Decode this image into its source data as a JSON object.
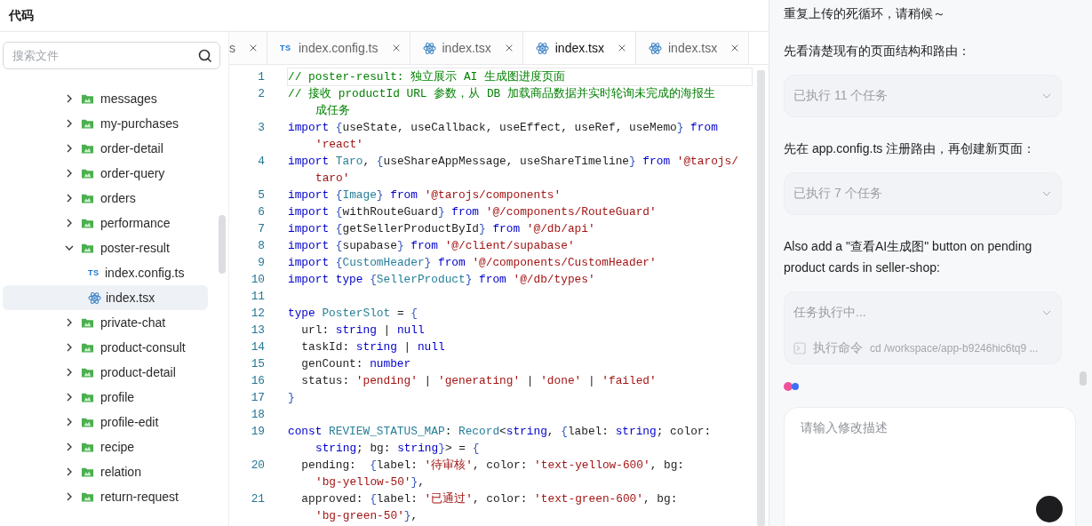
{
  "header": {
    "title": "代码"
  },
  "sidebar": {
    "search": {
      "placeholder": "搜索文件"
    },
    "tree": [
      {
        "kind": "folder",
        "label": "messages",
        "expanded": false,
        "selected": false
      },
      {
        "kind": "folder",
        "label": "my-purchases",
        "expanded": false,
        "selected": false
      },
      {
        "kind": "folder",
        "label": "order-detail",
        "expanded": false,
        "selected": false
      },
      {
        "kind": "folder",
        "label": "order-query",
        "expanded": false,
        "selected": false
      },
      {
        "kind": "folder",
        "label": "orders",
        "expanded": false,
        "selected": false
      },
      {
        "kind": "folder",
        "label": "performance",
        "expanded": false,
        "selected": false
      },
      {
        "kind": "folder",
        "label": "poster-result",
        "expanded": true,
        "selected": false,
        "children": [
          {
            "kind": "ts",
            "badge": "TS",
            "label": "index.config.ts",
            "selected": false
          },
          {
            "kind": "tsx",
            "label": "index.tsx",
            "selected": true
          }
        ]
      },
      {
        "kind": "folder",
        "label": "private-chat",
        "expanded": false,
        "selected": false
      },
      {
        "kind": "folder",
        "label": "product-consult",
        "expanded": false,
        "selected": false
      },
      {
        "kind": "folder",
        "label": "product-detail",
        "expanded": false,
        "selected": false
      },
      {
        "kind": "folder",
        "label": "profile",
        "expanded": false,
        "selected": false
      },
      {
        "kind": "folder",
        "label": "profile-edit",
        "expanded": false,
        "selected": false
      },
      {
        "kind": "folder",
        "label": "recipe",
        "expanded": false,
        "selected": false
      },
      {
        "kind": "folder",
        "label": "relation",
        "expanded": false,
        "selected": false
      },
      {
        "kind": "folder",
        "label": "return-request",
        "expanded": false,
        "selected": false
      }
    ]
  },
  "editor": {
    "tabs": [
      {
        "kind": "plain",
        "label": "s",
        "selected": false
      },
      {
        "kind": "ts",
        "badge": "TS",
        "label": "index.config.ts",
        "selected": false
      },
      {
        "kind": "tsx",
        "label": "index.tsx",
        "selected": false
      },
      {
        "kind": "tsx",
        "label": "index.tsx",
        "selected": true
      },
      {
        "kind": "tsx",
        "label": "index.tsx",
        "selected": false
      }
    ],
    "lines": [
      {
        "number": "1",
        "current": true,
        "rows": [
          {
            "tokens": [
              {
                "kind": "cm",
                "text": "// poster-result: 独立展示 AI 生成图进度页面"
              }
            ]
          }
        ]
      },
      {
        "number": "2",
        "current": false,
        "rows": [
          {
            "tokens": [
              {
                "kind": "cm",
                "text": "// 接收 productId URL 参数，从 DB 加载商品数据并实时轮询未完成的海报生"
              }
            ]
          },
          {
            "tokens": [
              {
                "kind": "cm",
                "text": "成任务"
              }
            ]
          }
        ]
      },
      {
        "number": "3",
        "current": false,
        "rows": [
          {
            "tokens": [
              {
                "kind": "kw",
                "text": "import "
              },
              {
                "kind": "br",
                "text": "{"
              },
              {
                "kind": "pl",
                "text": "useState, useCallback, useEffect, useRef, useMemo"
              },
              {
                "kind": "br",
                "text": "} "
              },
              {
                "kind": "kw",
                "text": "from"
              }
            ]
          },
          {
            "tokens": [
              {
                "kind": "st",
                "text": "'react'"
              }
            ]
          }
        ]
      },
      {
        "number": "4",
        "current": false,
        "rows": [
          {
            "tokens": [
              {
                "kind": "kw",
                "text": "import "
              },
              {
                "kind": "ty",
                "text": "Taro"
              },
              {
                "kind": "pl",
                "text": ", "
              },
              {
                "kind": "br",
                "text": "{"
              },
              {
                "kind": "pl",
                "text": "useShareAppMessage, useShareTimeline"
              },
              {
                "kind": "br",
                "text": "} "
              },
              {
                "kind": "kw",
                "text": "from "
              },
              {
                "kind": "st",
                "text": "'@tarojs/"
              }
            ]
          },
          {
            "tokens": [
              {
                "kind": "st",
                "text": "taro'"
              }
            ]
          }
        ]
      },
      {
        "number": "5",
        "current": false,
        "rows": [
          {
            "tokens": [
              {
                "kind": "kw",
                "text": "import "
              },
              {
                "kind": "br",
                "text": "{"
              },
              {
                "kind": "ty",
                "text": "Image"
              },
              {
                "kind": "br",
                "text": "} "
              },
              {
                "kind": "kw",
                "text": "from "
              },
              {
                "kind": "st",
                "text": "'@tarojs/components'"
              }
            ]
          }
        ]
      },
      {
        "number": "6",
        "current": false,
        "rows": [
          {
            "tokens": [
              {
                "kind": "kw",
                "text": "import "
              },
              {
                "kind": "br",
                "text": "{"
              },
              {
                "kind": "pl",
                "text": "withRouteGuard"
              },
              {
                "kind": "br",
                "text": "} "
              },
              {
                "kind": "kw",
                "text": "from "
              },
              {
                "kind": "st",
                "text": "'@/components/RouteGuard'"
              }
            ]
          }
        ]
      },
      {
        "number": "7",
        "current": false,
        "rows": [
          {
            "tokens": [
              {
                "kind": "kw",
                "text": "import "
              },
              {
                "kind": "br",
                "text": "{"
              },
              {
                "kind": "pl",
                "text": "getSellerProductById"
              },
              {
                "kind": "br",
                "text": "} "
              },
              {
                "kind": "kw",
                "text": "from "
              },
              {
                "kind": "st",
                "text": "'@/db/api'"
              }
            ]
          }
        ]
      },
      {
        "number": "8",
        "current": false,
        "rows": [
          {
            "tokens": [
              {
                "kind": "kw",
                "text": "import "
              },
              {
                "kind": "br",
                "text": "{"
              },
              {
                "kind": "pl",
                "text": "supabase"
              },
              {
                "kind": "br",
                "text": "} "
              },
              {
                "kind": "kw",
                "text": "from "
              },
              {
                "kind": "st",
                "text": "'@/client/supabase'"
              }
            ]
          }
        ]
      },
      {
        "number": "9",
        "current": false,
        "rows": [
          {
            "tokens": [
              {
                "kind": "kw",
                "text": "import "
              },
              {
                "kind": "br",
                "text": "{"
              },
              {
                "kind": "ty",
                "text": "CustomHeader"
              },
              {
                "kind": "br",
                "text": "} "
              },
              {
                "kind": "kw",
                "text": "from "
              },
              {
                "kind": "st",
                "text": "'@/components/CustomHeader'"
              }
            ]
          }
        ]
      },
      {
        "number": "10",
        "current": false,
        "rows": [
          {
            "tokens": [
              {
                "kind": "kw",
                "text": "import type "
              },
              {
                "kind": "br",
                "text": "{"
              },
              {
                "kind": "ty",
                "text": "SellerProduct"
              },
              {
                "kind": "br",
                "text": "} "
              },
              {
                "kind": "kw",
                "text": "from "
              },
              {
                "kind": "st",
                "text": "'@/db/types'"
              }
            ]
          }
        ]
      },
      {
        "number": "11",
        "current": false
      },
      {
        "number": "12",
        "current": false,
        "rows": [
          {
            "tokens": [
              {
                "kind": "kw",
                "text": "type "
              },
              {
                "kind": "ty",
                "text": "PosterSlot"
              },
              {
                "kind": "pl",
                "text": " = "
              },
              {
                "kind": "br",
                "text": "{"
              }
            ]
          }
        ]
      },
      {
        "number": "13",
        "current": false,
        "rows": [
          {
            "tokens": [
              {
                "kind": "pl",
                "text": "  url: "
              },
              {
                "kind": "kw",
                "text": "string"
              },
              {
                "kind": "pl",
                "text": " | "
              },
              {
                "kind": "kw",
                "text": "null"
              }
            ]
          }
        ]
      },
      {
        "number": "14",
        "current": false,
        "rows": [
          {
            "tokens": [
              {
                "kind": "pl",
                "text": "  taskId: "
              },
              {
                "kind": "kw",
                "text": "string"
              },
              {
                "kind": "pl",
                "text": " | "
              },
              {
                "kind": "kw",
                "text": "null"
              }
            ]
          }
        ]
      },
      {
        "number": "15",
        "current": false,
        "rows": [
          {
            "tokens": [
              {
                "kind": "pl",
                "text": "  genCount: "
              },
              {
                "kind": "kw",
                "text": "number"
              }
            ]
          }
        ]
      },
      {
        "number": "16",
        "current": false,
        "rows": [
          {
            "tokens": [
              {
                "kind": "pl",
                "text": "  status: "
              },
              {
                "kind": "st",
                "text": "'pending'"
              },
              {
                "kind": "pl",
                "text": " | "
              },
              {
                "kind": "st",
                "text": "'generating'"
              },
              {
                "kind": "pl",
                "text": " | "
              },
              {
                "kind": "st",
                "text": "'done'"
              },
              {
                "kind": "pl",
                "text": " | "
              },
              {
                "kind": "st",
                "text": "'failed'"
              }
            ]
          }
        ]
      },
      {
        "number": "17",
        "current": false,
        "rows": [
          {
            "tokens": [
              {
                "kind": "br",
                "text": "}"
              }
            ]
          }
        ]
      },
      {
        "number": "18",
        "current": false
      },
      {
        "number": "19",
        "current": false,
        "rows": [
          {
            "tokens": [
              {
                "kind": "kw",
                "text": "const "
              },
              {
                "kind": "ty",
                "text": "REVIEW_STATUS_MAP"
              },
              {
                "kind": "pl",
                "text": ": "
              },
              {
                "kind": "ty",
                "text": "Record"
              },
              {
                "kind": "pl",
                "text": "<"
              },
              {
                "kind": "kw",
                "text": "string"
              },
              {
                "kind": "pl",
                "text": ", "
              },
              {
                "kind": "br",
                "text": "{"
              },
              {
                "kind": "pl",
                "text": "label: "
              },
              {
                "kind": "kw",
                "text": "string"
              },
              {
                "kind": "pl",
                "text": "; color:"
              }
            ]
          },
          {
            "tokens": [
              {
                "kind": "kw",
                "text": "string"
              },
              {
                "kind": "pl",
                "text": "; bg: "
              },
              {
                "kind": "kw",
                "text": "string"
              },
              {
                "kind": "br",
                "text": "}"
              },
              {
                "kind": "pl",
                "text": "> = "
              },
              {
                "kind": "br",
                "text": "{"
              }
            ]
          }
        ]
      },
      {
        "number": "20",
        "current": false,
        "rows": [
          {
            "tokens": [
              {
                "kind": "pl",
                "text": "  pending:  "
              },
              {
                "kind": "br",
                "text": "{"
              },
              {
                "kind": "pl",
                "text": "label: "
              },
              {
                "kind": "st",
                "text": "'待审核'"
              },
              {
                "kind": "pl",
                "text": ", color: "
              },
              {
                "kind": "st",
                "text": "'text-yellow-600'"
              },
              {
                "kind": "pl",
                "text": ", bg:"
              }
            ]
          },
          {
            "tokens": [
              {
                "kind": "st",
                "text": "'bg-yellow-50'"
              },
              {
                "kind": "br",
                "text": "}"
              },
              {
                "kind": "pl",
                "text": ","
              }
            ]
          }
        ]
      },
      {
        "number": "21",
        "current": false,
        "rows": [
          {
            "tokens": [
              {
                "kind": "pl",
                "text": "  approved: "
              },
              {
                "kind": "br",
                "text": "{"
              },
              {
                "kind": "pl",
                "text": "label: "
              },
              {
                "kind": "st",
                "text": "'已通过'"
              },
              {
                "kind": "pl",
                "text": ", color: "
              },
              {
                "kind": "st",
                "text": "'text-green-600'"
              },
              {
                "kind": "pl",
                "text": ", bg:"
              }
            ]
          },
          {
            "tokens": [
              {
                "kind": "st",
                "text": "'bg-green-50'"
              },
              {
                "kind": "br",
                "text": "}"
              },
              {
                "kind": "pl",
                "text": ","
              }
            ]
          }
        ]
      }
    ]
  },
  "chat": {
    "items": [
      {
        "kind": "text",
        "text": "重复上传的死循环，请稍候～"
      },
      {
        "kind": "text",
        "text": "先看清楚现有的页面结构和路由："
      },
      {
        "kind": "task",
        "title": "已执行 11 个任务"
      },
      {
        "kind": "text",
        "text": "先在 app.config.ts 注册路由，再创建新页面："
      },
      {
        "kind": "task",
        "title": "已执行 7 个任务"
      },
      {
        "kind": "text",
        "text": "Also add a \"查看AI生成图\" button on pending product cards in seller-shop:"
      },
      {
        "kind": "task",
        "title": "任务执行中...",
        "command_label": "执行命令",
        "command": "cd /workspace/app-b9246hic6tq9 ..."
      },
      {
        "kind": "typing"
      }
    ],
    "input": {
      "placeholder": "请输入修改描述"
    }
  }
}
